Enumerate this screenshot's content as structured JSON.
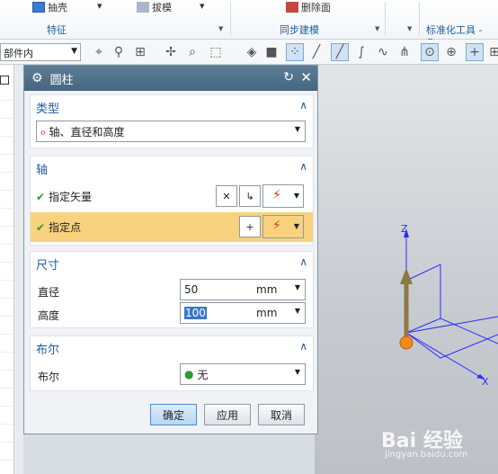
{
  "ribbon": {
    "items": [
      "抽壳",
      "拔模"
    ],
    "groups": [
      "特征",
      "同步建模",
      "标准化工具 - G..."
    ],
    "partial_items": [
      "删除面"
    ]
  },
  "toolbar": {
    "scope": "部件内"
  },
  "dialog": {
    "title": "圆柱",
    "sections": {
      "type": {
        "title": "类型",
        "value": "轴、直径和高度"
      },
      "axis": {
        "title": "轴",
        "vector_label": "指定矢量",
        "point_label": "指定点"
      },
      "dims": {
        "title": "尺寸",
        "diameter_label": "直径",
        "diameter_value": "50",
        "diameter_unit": "mm",
        "height_label": "高度",
        "height_value": "100",
        "height_unit": "mm"
      },
      "boolean": {
        "title": "布尔",
        "label": "布尔",
        "value": "无"
      }
    },
    "buttons": {
      "ok": "确定",
      "apply": "应用",
      "cancel": "取消"
    }
  },
  "viewport": {
    "axis_z": "Z",
    "axis_x": "X",
    "watermark": "Bai 经验",
    "watermark_sub": "jingyan.baidu.com"
  },
  "colors": {
    "accent": "#1f5b9f",
    "highlight": "#f9d27f",
    "title_bar": "#456680"
  }
}
